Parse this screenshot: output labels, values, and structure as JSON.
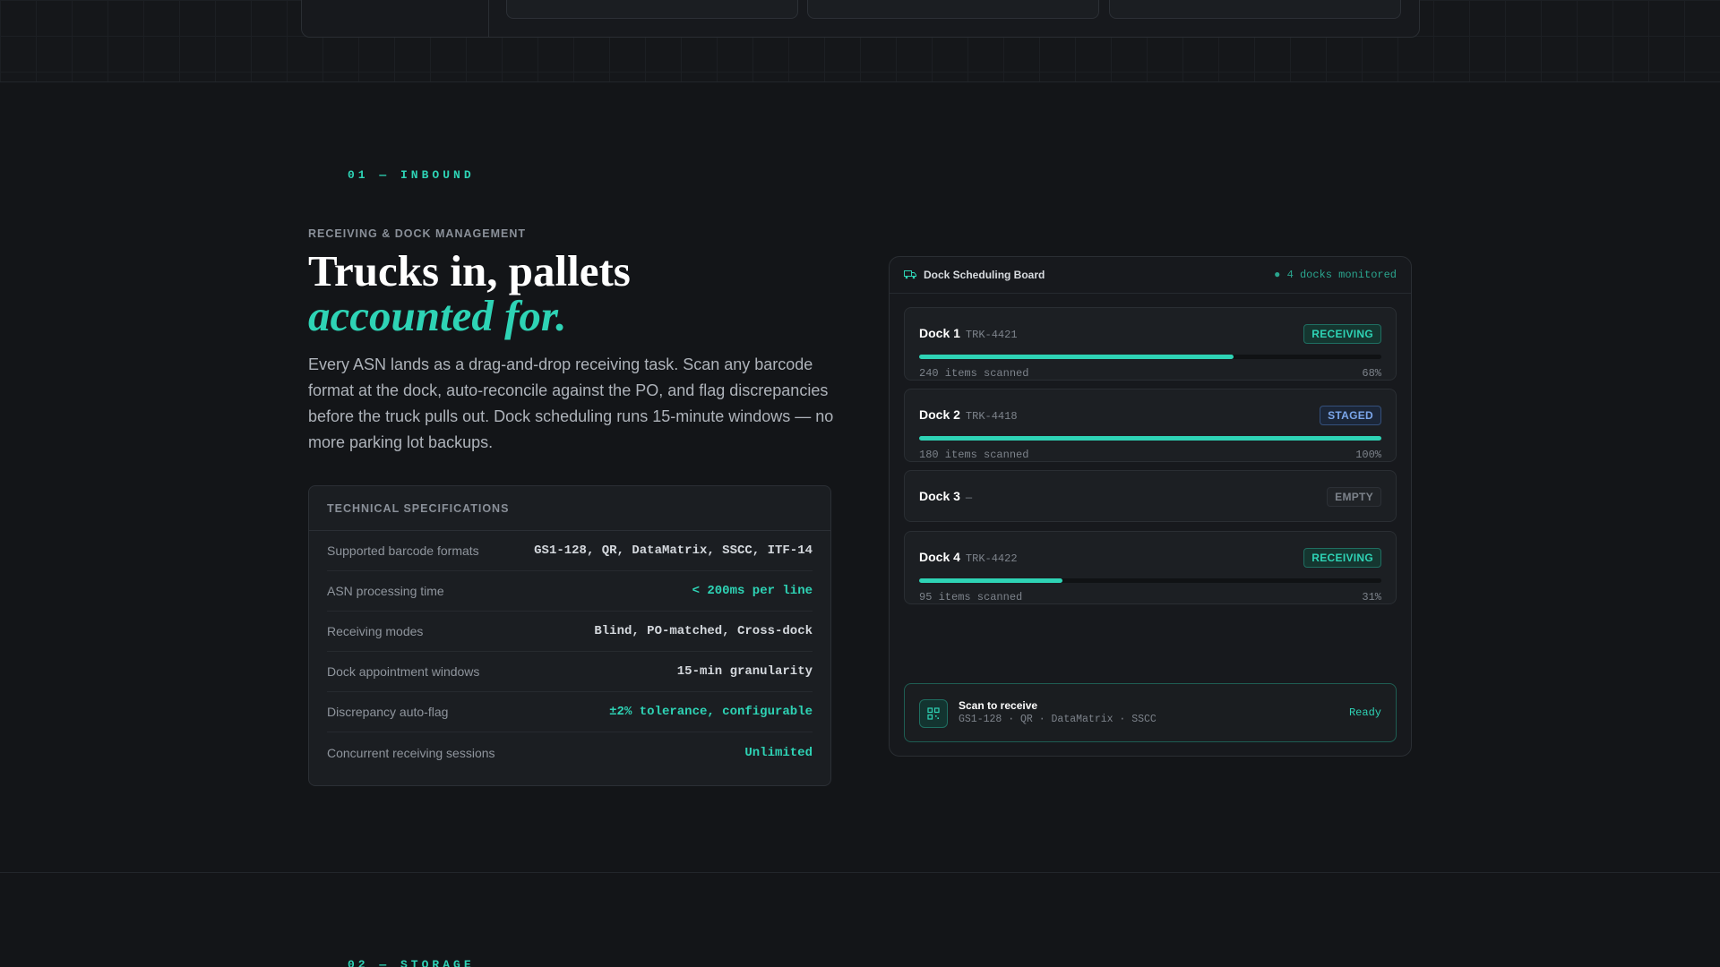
{
  "section": {
    "eyebrow": "01 — INBOUND",
    "kicker": "RECEIVING & DOCK MANAGEMENT",
    "title_line1": "Trucks in, pallets",
    "title_line2": "accounted for.",
    "lead": "Every ASN lands as a drag-and-drop receiving task. Scan any barcode format at the dock, auto-reconcile against the PO, and flag discrepancies before the truck pulls out. Dock scheduling runs 15-minute windows — no more parking lot backups."
  },
  "specs": {
    "heading": "TECHNICAL SPECIFICATIONS",
    "rows": [
      {
        "label": "Supported barcode formats",
        "value": "GS1-128, QR, DataMatrix, SSCC, ITF-14",
        "accent": false
      },
      {
        "label": "ASN processing time",
        "value": "< 200ms per line",
        "accent": true
      },
      {
        "label": "Receiving modes",
        "value": "Blind, PO-matched, Cross-dock",
        "accent": false
      },
      {
        "label": "Dock appointment windows",
        "value": "15-min granularity",
        "accent": false
      },
      {
        "label": "Discrepancy auto-flag",
        "value": "±2% tolerance, configurable",
        "accent": true
      },
      {
        "label": "Concurrent receiving sessions",
        "value": "Unlimited",
        "accent": true
      }
    ]
  },
  "board": {
    "title": "Dock Scheduling Board",
    "status": "● 4 docks monitored",
    "docks": [
      {
        "name": "Dock 1",
        "truck": "TRK-4421",
        "status": "RECEIVING",
        "status_kind": "receiving",
        "scanned": "240 items scanned",
        "percent_label": "68%",
        "progress": 0.68
      },
      {
        "name": "Dock 2",
        "truck": "TRK-4418",
        "status": "STAGED",
        "status_kind": "staged",
        "scanned": "180 items scanned",
        "percent_label": "100%",
        "progress": 1.0
      },
      {
        "name": "Dock 3",
        "truck": "—",
        "status": "EMPTY",
        "status_kind": "empty"
      },
      {
        "name": "Dock 4",
        "truck": "TRK-4422",
        "status": "RECEIVING",
        "status_kind": "receiving",
        "scanned": "95 items scanned",
        "percent_label": "31%",
        "progress": 0.31
      }
    ],
    "scan": {
      "title": "Scan to receive",
      "formats": "GS1-128 · QR · DataMatrix · SSCC",
      "status": "Ready",
      "icon": "qr-code-icon"
    }
  },
  "next_section": {
    "eyebrow": "02 — STORAGE"
  },
  "colors": {
    "accent": "#2ed3b5",
    "background": "#131518",
    "staged": "#7ba6ea"
  }
}
